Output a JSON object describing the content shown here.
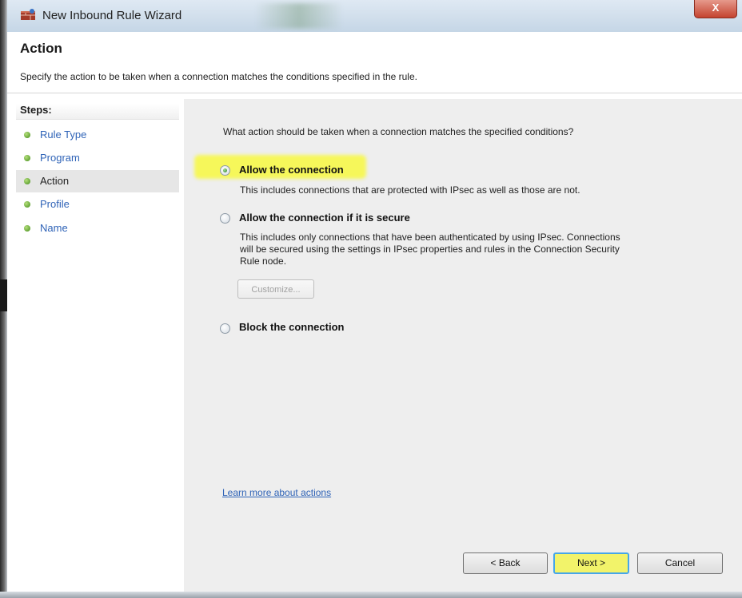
{
  "window": {
    "title": "New Inbound Rule Wizard",
    "close_label": "X"
  },
  "header": {
    "title": "Action",
    "subtitle": "Specify the action to be taken when a connection matches the conditions specified in the rule."
  },
  "steps": {
    "title": "Steps:",
    "items": [
      {
        "label": "Rule Type",
        "state": "link"
      },
      {
        "label": "Program",
        "state": "link"
      },
      {
        "label": "Action",
        "state": "current"
      },
      {
        "label": "Profile",
        "state": "link"
      },
      {
        "label": "Name",
        "state": "link"
      }
    ]
  },
  "main": {
    "question": "What action should be taken when a connection matches the specified conditions?",
    "options": [
      {
        "label": "Allow the connection",
        "description": "This includes connections that are protected with IPsec as well as those are not.",
        "selected": true
      },
      {
        "label": "Allow the connection if it is secure",
        "description_lines": [
          "This includes only connections that have been authenticated by using IPsec.  Connections",
          "will be secured using the settings in IPsec properties and rules in the Connection Security",
          "Rule node."
        ],
        "selected": false
      },
      {
        "label": "Block the connection",
        "selected": false
      }
    ],
    "customize_label": "Customize...",
    "learn_more": "Learn more about actions"
  },
  "buttons": {
    "back": "< Back",
    "next": "Next >",
    "cancel": "Cancel"
  },
  "colors": {
    "highlight": "#f6f75a",
    "link": "#2f63b7",
    "panel_bg": "#eeeeee"
  }
}
